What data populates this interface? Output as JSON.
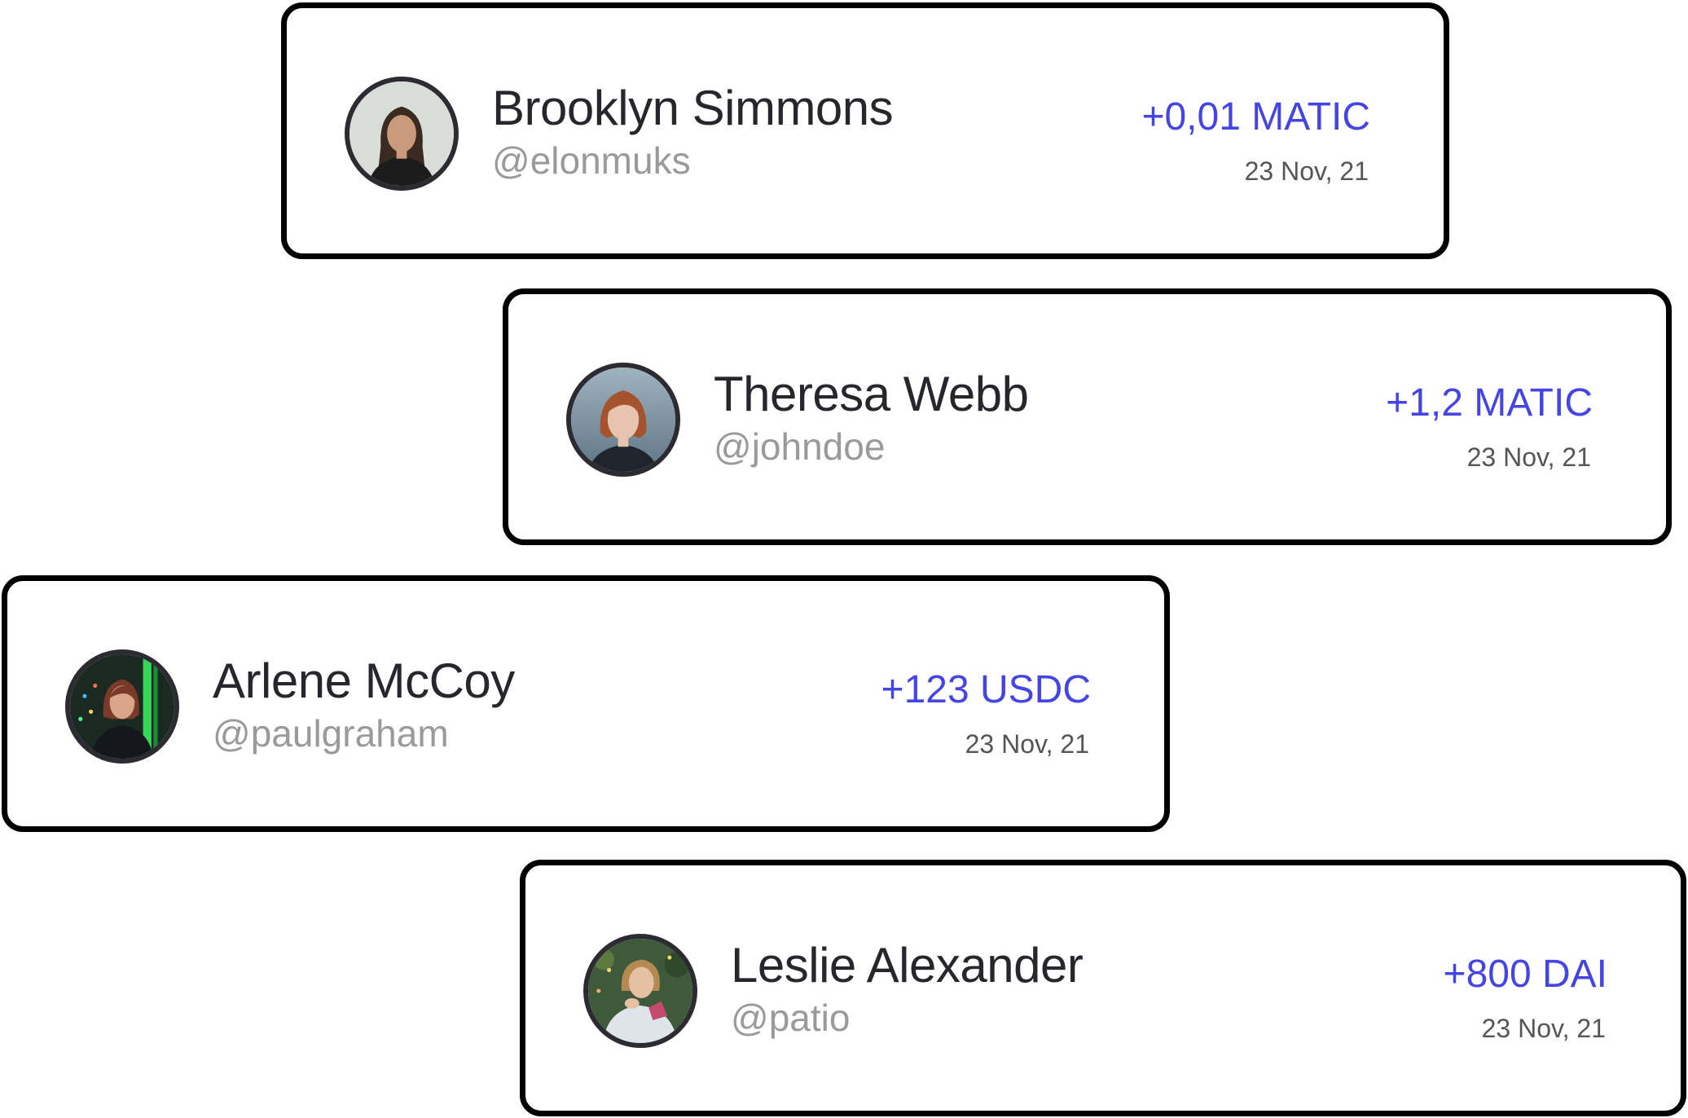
{
  "transactions": [
    {
      "name": "Brooklyn Simmons",
      "handle": "@elonmuks",
      "amount": "+0,01 MATIC",
      "date": "23 Nov, 21",
      "avatar_icon": "avatar-woman-dark-hair",
      "colors": {
        "photo_bg": "#d9dcd9",
        "hair": "#3a2a22",
        "skin": "#c99a7c",
        "shirt": "#1c1c1c"
      }
    },
    {
      "name": "Theresa Webb",
      "handle": "@johndoe",
      "amount": "+1,2 MATIC",
      "date": "23 Nov, 21",
      "avatar_icon": "avatar-woman-red-hair",
      "colors": {
        "photo_bg": "#7d94a5",
        "hair": "#a5522e",
        "skin": "#e8c3ad",
        "shirt": "#20242c"
      }
    },
    {
      "name": "Arlene McCoy",
      "handle": "@paulgraham",
      "amount": "+123 USDC",
      "date": "23 Nov, 21",
      "avatar_icon": "avatar-woman-neon-light",
      "colors": {
        "photo_bg": "#1a2a22",
        "hair": "#7a3a28",
        "skin": "#d9a48a",
        "shirt": "#14181c"
      }
    },
    {
      "name": "Leslie Alexander",
      "handle": "@patio",
      "amount": "+800 DAI",
      "date": "23 Nov, 21",
      "avatar_icon": "avatar-woman-garden",
      "colors": {
        "photo_bg": "#3f5a3a",
        "hair": "#b58a52",
        "skin": "#e6c0a2",
        "shirt": "#dfe3ea"
      }
    }
  ],
  "theme": {
    "amount_color": "#4545e3",
    "name_color": "#26262c",
    "handle_color": "#9a9a9a",
    "date_color": "#555555",
    "card_border": "#000000",
    "avatar_ring": "#2b2b31"
  }
}
